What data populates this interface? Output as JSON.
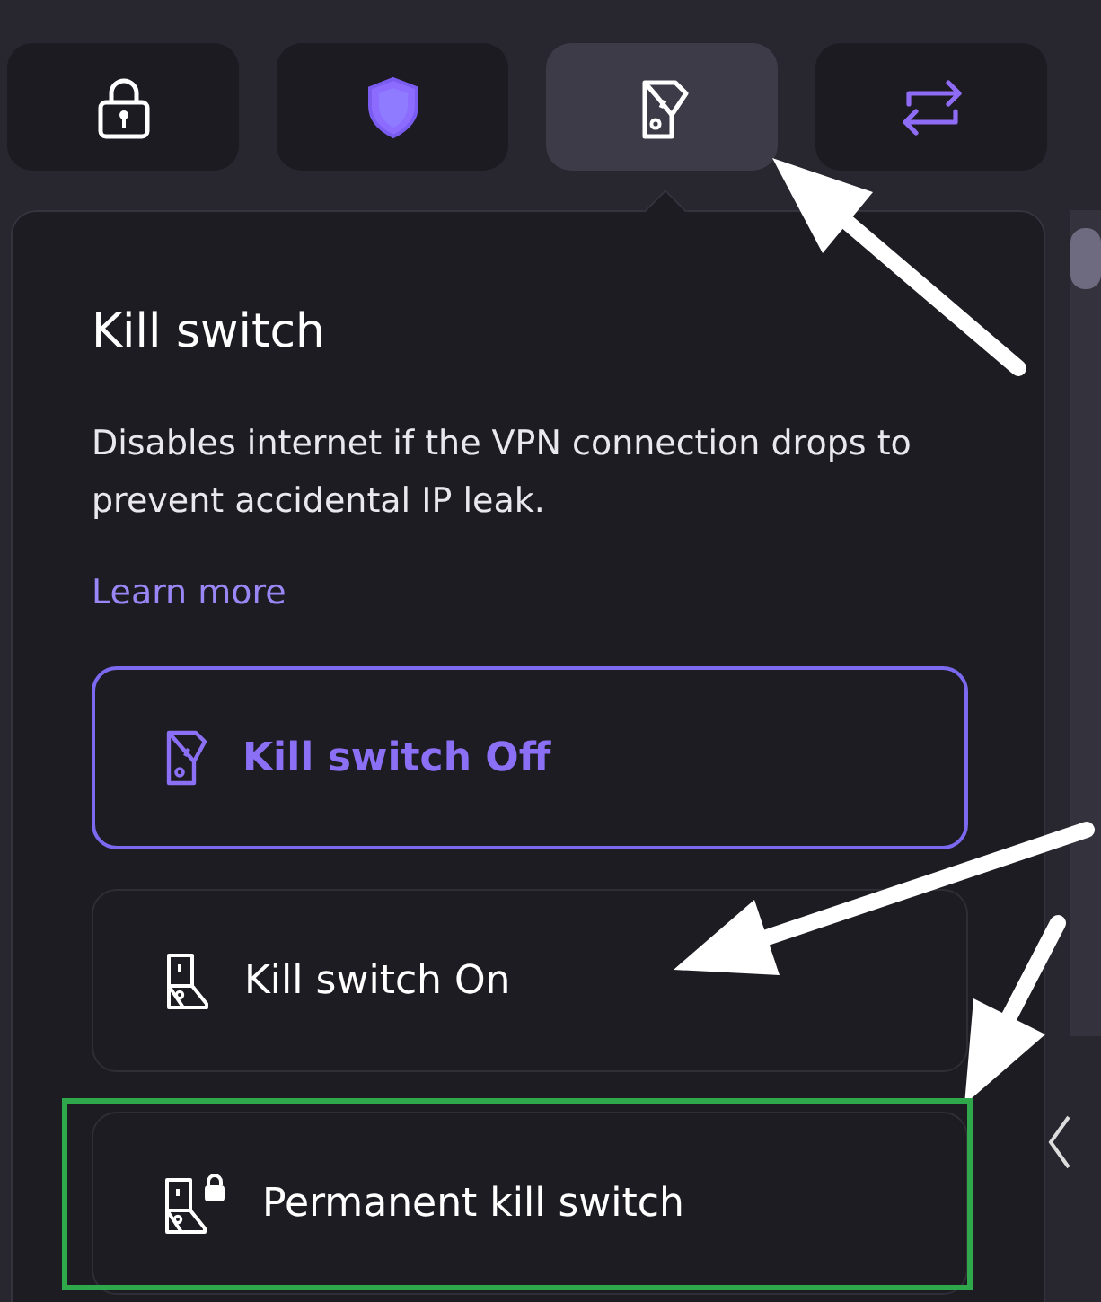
{
  "tabs": [
    {
      "kind": "lock",
      "selected": false
    },
    {
      "kind": "shield",
      "selected": false
    },
    {
      "kind": "switch",
      "selected": true
    },
    {
      "kind": "arrows",
      "selected": false
    }
  ],
  "panel": {
    "title": "Kill switch",
    "description": "Disables internet if the VPN connection drops to prevent accidental IP leak.",
    "link": "Learn more"
  },
  "options": [
    {
      "kind": "off",
      "label": "Kill switch Off",
      "selected": true
    },
    {
      "kind": "on",
      "label": "Kill switch On",
      "selected": false
    },
    {
      "kind": "permanent",
      "label": "Permanent kill switch",
      "selected": false
    }
  ]
}
